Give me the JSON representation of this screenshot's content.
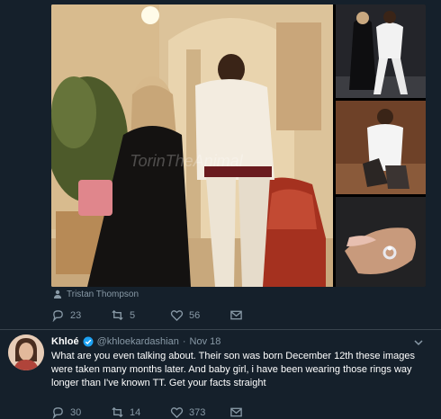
{
  "media": {
    "watermark": "TorinTheAnimal",
    "credit_name": "Tristan Thompson"
  },
  "first_tweet_actions": {
    "replies": "23",
    "retweets": "5",
    "likes": "56"
  },
  "reply_tweet": {
    "display_name": "Khloé",
    "handle": "@khloekardashian",
    "separator": "·",
    "date": "Nov 18",
    "text": "What are you even talking about. Their son was born December 12th these images were taken many months later. And baby girl, i have been wearing those rings way longer than I've known TT. Get your facts straight",
    "replies": "30",
    "retweets": "14",
    "likes": "373"
  },
  "colors": {
    "background": "#15202b",
    "muted_text": "#8899a6",
    "divider": "#38444d",
    "verified": "#1da1f2"
  },
  "icons": [
    "reply-icon",
    "retweet-icon",
    "like-icon",
    "share-mail-icon",
    "verified-icon",
    "chevron-down-icon",
    "person-tag-icon"
  ]
}
